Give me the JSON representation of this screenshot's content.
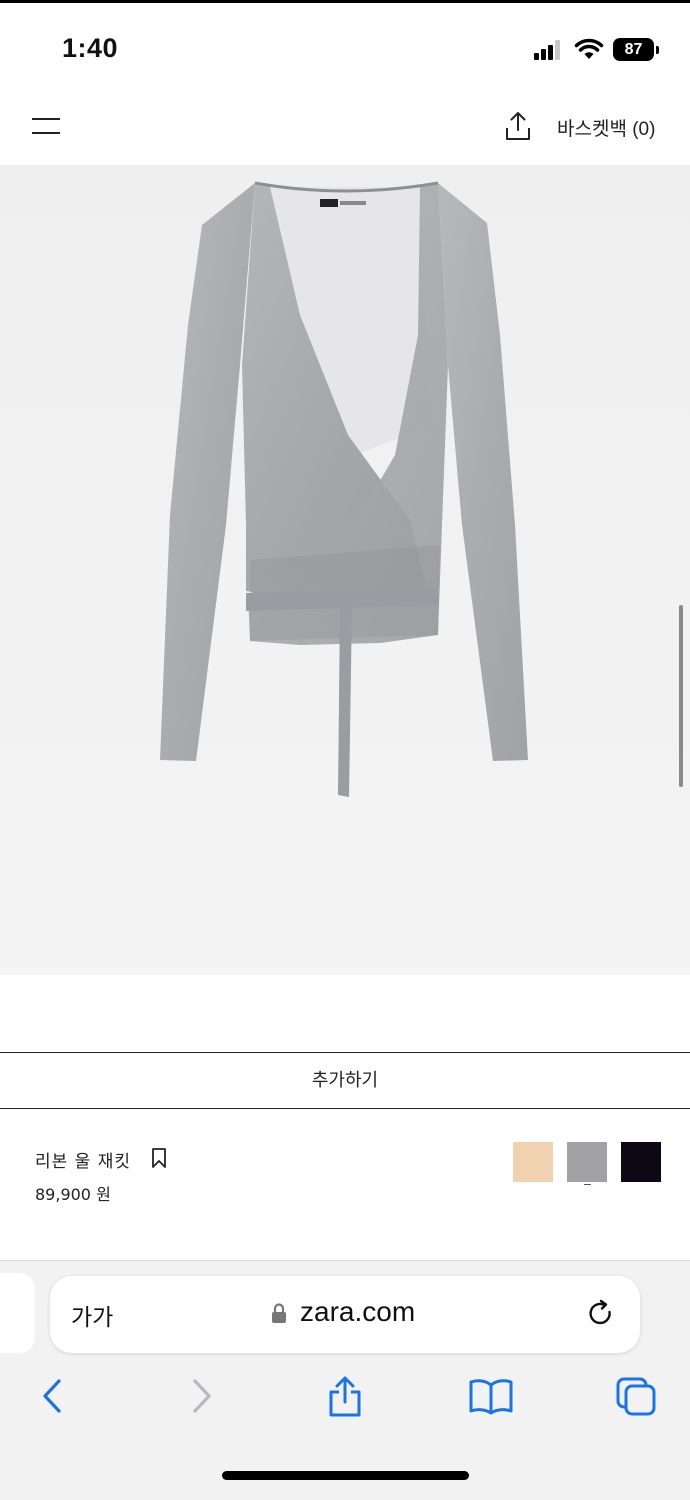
{
  "status_bar": {
    "time": "1:40",
    "battery": "87"
  },
  "header": {
    "basket_label": "바스켓백 (0)"
  },
  "product": {
    "add_label": "추가하기",
    "name": "리본 울 재킷",
    "price": "89,900 원",
    "colors": [
      "#f0d2b0",
      "#a2a2a4",
      "#0d0914"
    ]
  },
  "browser": {
    "aa_label": "가가",
    "url": "zara.com"
  }
}
